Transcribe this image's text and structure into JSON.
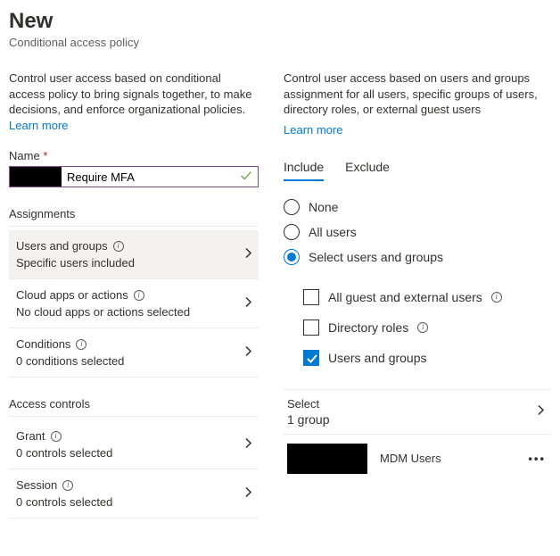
{
  "header": {
    "title": "New",
    "subtitle": "Conditional access policy"
  },
  "left": {
    "intro_text": "Control user access based on conditional access policy to bring signals together, to make decisions, and enforce organizational policies. ",
    "learn_more": "Learn more",
    "name_label": "Name",
    "name_value": "Require MFA",
    "sections": {
      "assignments": "Assignments",
      "access_controls": "Access controls"
    },
    "rows": {
      "users_groups": {
        "title": "Users and groups",
        "sub": "Specific users included"
      },
      "cloud_apps": {
        "title": "Cloud apps or actions",
        "sub": "No cloud apps or actions selected"
      },
      "conditions": {
        "title": "Conditions",
        "sub": "0 conditions selected"
      },
      "grant": {
        "title": "Grant",
        "sub": "0 controls selected"
      },
      "session": {
        "title": "Session",
        "sub": "0 controls selected"
      }
    }
  },
  "right": {
    "intro_text": "Control user access based on users and groups assignment for all users, specific groups of users, directory roles, or external guest users",
    "learn_more": "Learn more",
    "tabs": {
      "include": "Include",
      "exclude": "Exclude"
    },
    "radios": {
      "none": "None",
      "all": "All users",
      "select": "Select users and groups"
    },
    "checkboxes": {
      "guest": "All guest and external users",
      "dir_roles": "Directory roles",
      "users_groups": "Users and groups"
    },
    "select": {
      "label": "Select",
      "value": "1 group"
    },
    "selected_item": {
      "name": "MDM Users"
    }
  }
}
